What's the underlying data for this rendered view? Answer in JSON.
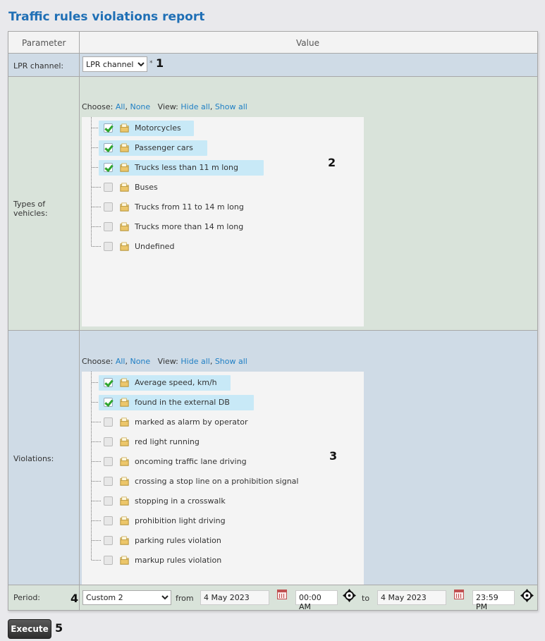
{
  "title": "Traffic rules violations report",
  "header": {
    "parameter": "Parameter",
    "value": "Value"
  },
  "lpr": {
    "label": "LPR channel:",
    "selected": "LPR channel 1",
    "required_mark": "*",
    "callout": "1"
  },
  "choose_bar": {
    "choose_label": "Choose:",
    "all": "All",
    "none": "None",
    "view_label": "View:",
    "hide_all": "Hide all",
    "show_all": "Show all"
  },
  "vehicles": {
    "label": "Types of vehicles:",
    "callout": "2",
    "items": [
      {
        "label": "Motorcycles",
        "checked": true
      },
      {
        "label": "Passenger cars",
        "checked": true
      },
      {
        "label": "Trucks less than 11 m long",
        "checked": true
      },
      {
        "label": "Buses",
        "checked": false
      },
      {
        "label": "Trucks from 11 to 14 m long",
        "checked": false
      },
      {
        "label": "Trucks more than 14 m long",
        "checked": false
      },
      {
        "label": "Undefined",
        "checked": false
      }
    ]
  },
  "violations": {
    "label": "Violations:",
    "callout": "3",
    "items": [
      {
        "label": "Average speed, km/h",
        "checked": true
      },
      {
        "label": "found in the external DB",
        "checked": true
      },
      {
        "label": "marked as alarm by operator",
        "checked": false
      },
      {
        "label": "red light running",
        "checked": false
      },
      {
        "label": "oncoming traffic lane driving",
        "checked": false
      },
      {
        "label": "crossing a stop line on a prohibition signal",
        "checked": false
      },
      {
        "label": "stopping in a crosswalk",
        "checked": false
      },
      {
        "label": "prohibition light driving",
        "checked": false
      },
      {
        "label": "parking rules violation",
        "checked": false
      },
      {
        "label": "markup rules violation",
        "checked": false
      }
    ]
  },
  "period": {
    "label": "Period:",
    "callout": "4",
    "selected": "Custom 2",
    "from_label": "from",
    "from_date": "4 May 2023",
    "from_time": "00:00 AM",
    "to_label": "to",
    "to_date": "4 May 2023",
    "to_time": "23:59 PM"
  },
  "execute": {
    "label": "Execute",
    "callout": "5"
  },
  "colors": {
    "title": "#1f6fb5",
    "link": "#1f7fc4",
    "selected_item": "#c8e9f7",
    "check": "#2fa52f",
    "row_blue": "#cfdbe6",
    "row_green": "#d9e3da"
  },
  "icons": {
    "checkbox": "checkbox-icon",
    "folder": "folder-icon",
    "calendar": "calendar-icon",
    "time_picker": "crosshair-icon"
  }
}
